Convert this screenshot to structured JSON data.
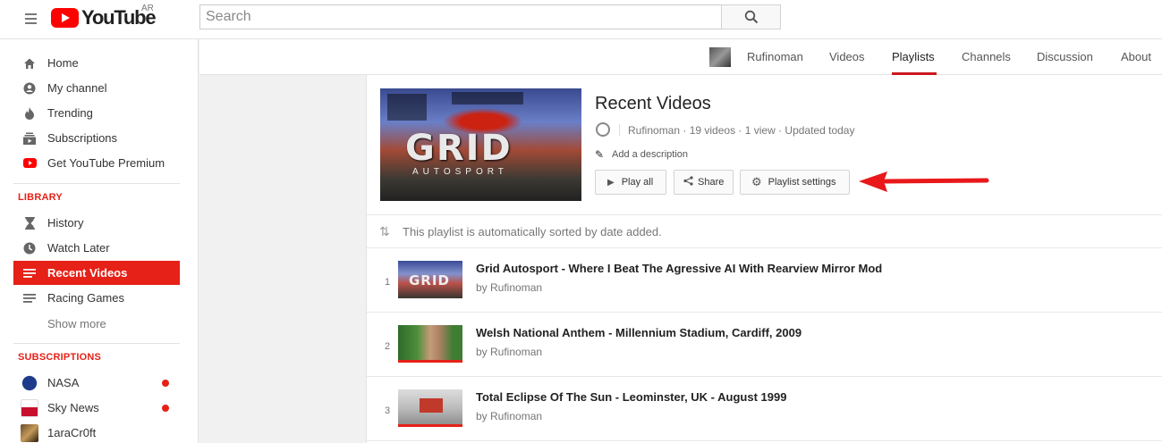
{
  "header": {
    "logo_text": "YouTube",
    "country_code": "AR",
    "search_placeholder": "Search"
  },
  "sidebar": {
    "main": [
      {
        "label": "Home",
        "icon": "home-icon"
      },
      {
        "label": "My channel",
        "icon": "account-icon"
      },
      {
        "label": "Trending",
        "icon": "flame-icon"
      },
      {
        "label": "Subscriptions",
        "icon": "subscriptions-icon"
      },
      {
        "label": "Get YouTube Premium",
        "icon": "youtube-icon"
      }
    ],
    "library_title": "LIBRARY",
    "library": [
      {
        "label": "History",
        "icon": "hourglass-icon"
      },
      {
        "label": "Watch Later",
        "icon": "clock-icon"
      },
      {
        "label": "Recent Videos",
        "icon": "list-icon",
        "active": true
      },
      {
        "label": "Racing Games",
        "icon": "list-icon"
      }
    ],
    "show_more": "Show more",
    "subscriptions_title": "SUBSCRIPTIONS",
    "subscriptions": [
      {
        "label": "NASA",
        "new": true
      },
      {
        "label": "Sky News",
        "new": true
      },
      {
        "label": "1araCr0ft",
        "new": false
      }
    ]
  },
  "channel_nav": {
    "channel_name": "Rufinoman",
    "tabs": [
      "Videos",
      "Playlists",
      "Channels",
      "Discussion",
      "About"
    ],
    "active_tab": "Playlists"
  },
  "playlist": {
    "title": "Recent Videos",
    "owner": "Rufinoman",
    "meta": "Rufinoman · 19 videos · 1 view · Updated today",
    "add_description": "Add a description",
    "thumb_title": "GRID",
    "thumb_subtitle": "AUTOSPORT",
    "buttons": {
      "play_all": "Play all",
      "share": "Share",
      "settings": "Playlist settings"
    },
    "sort_note": "This playlist is automatically sorted by date added."
  },
  "videos": [
    {
      "index": "1",
      "title": "Grid Autosport - Where I Beat The Agressive AI With Rearview Mirror Mod",
      "by": "by Rufinoman"
    },
    {
      "index": "2",
      "title": "Welsh National Anthem - Millennium Stadium, Cardiff, 2009",
      "by": "by Rufinoman"
    },
    {
      "index": "3",
      "title": "Total Eclipse Of The Sun - Leominster, UK - August 1999",
      "by": "by Rufinoman"
    }
  ],
  "colors": {
    "brand_red": "#ff0000",
    "active_red": "#e62117",
    "annotation_arrow": "#e8181b"
  }
}
